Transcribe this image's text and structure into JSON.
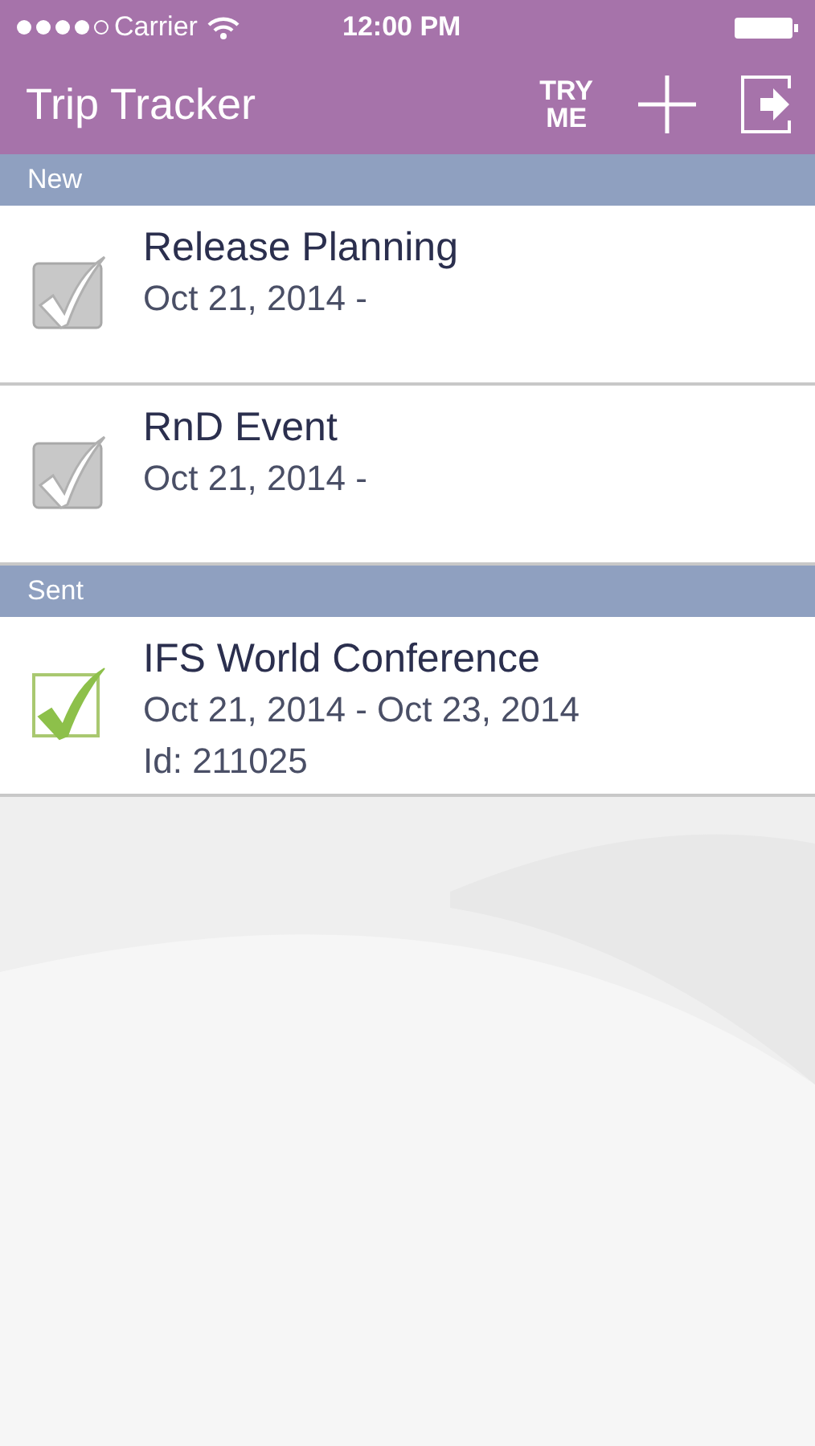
{
  "status_bar": {
    "carrier": "Carrier",
    "time": "12:00 PM"
  },
  "nav_bar": {
    "title": "Trip Tracker",
    "try_me": [
      "TRY",
      "ME"
    ]
  },
  "sections": [
    {
      "title": "New",
      "trips": [
        {
          "name": "Release Planning",
          "dates": "Oct 21, 2014 -",
          "kind": "draft"
        },
        {
          "name": "RnD Event",
          "dates": "Oct 21, 2014 -",
          "kind": "draft"
        }
      ]
    },
    {
      "title": "Sent",
      "trips": [
        {
          "name": "IFS World Conference",
          "dates": "Oct 21, 2014 - Oct 23, 2014",
          "id": "Id: 211025",
          "kind": "sent"
        }
      ]
    }
  ]
}
